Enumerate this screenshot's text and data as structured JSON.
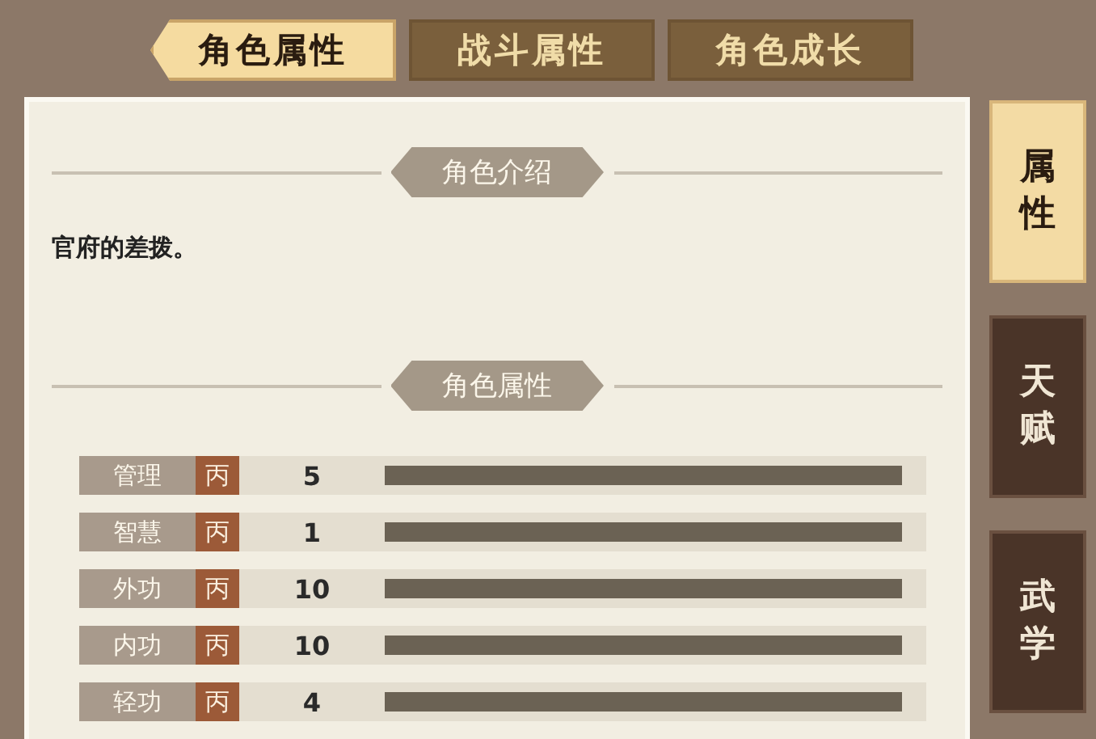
{
  "tabs": [
    {
      "label": "角色属性",
      "selected": true
    },
    {
      "label": "战斗属性",
      "selected": false
    },
    {
      "label": "角色成长",
      "selected": false
    }
  ],
  "side_tabs": [
    {
      "label": "属性",
      "selected": true
    },
    {
      "label": "天赋",
      "selected": false
    },
    {
      "label": "武学",
      "selected": false
    }
  ],
  "intro": {
    "title": "角色介绍",
    "text": "官府的差拨。"
  },
  "attributes": {
    "title": "角色属性",
    "rows": [
      {
        "name": "管理",
        "grade": "丙",
        "value": "5"
      },
      {
        "name": "智慧",
        "grade": "丙",
        "value": "1"
      },
      {
        "name": "外功",
        "grade": "丙",
        "value": "10"
      },
      {
        "name": "内功",
        "grade": "丙",
        "value": "10"
      },
      {
        "name": "轻功",
        "grade": "丙",
        "value": "4"
      }
    ]
  }
}
